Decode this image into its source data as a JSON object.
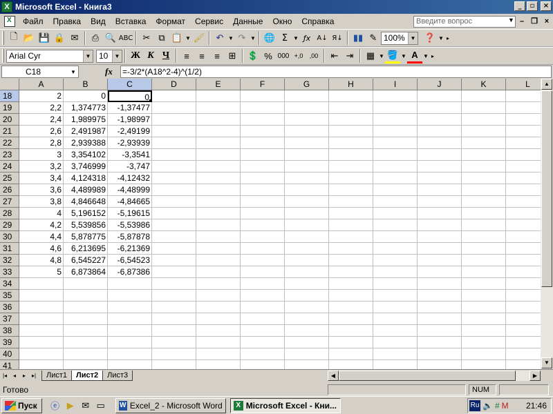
{
  "window": {
    "title": "Microsoft Excel - Книга3",
    "btn_min": "_",
    "btn_max": "▫",
    "btn_close": "×"
  },
  "menu": {
    "items": [
      "Файл",
      "Правка",
      "Вид",
      "Вставка",
      "Формат",
      "Сервис",
      "Данные",
      "Окно",
      "Справка"
    ],
    "help_placeholder": "Введите вопрос"
  },
  "toolbar": {
    "zoom": "100%",
    "font_name": "Arial Cyr",
    "font_size": "10",
    "bold": "Ж",
    "italic": "К",
    "underline": "Ч",
    "percent": "%",
    "thousands": "000",
    "inc_decimal": "+,0",
    "dec_decimal": ",00"
  },
  "formula_bar": {
    "name_box": "C18",
    "fx": "fx",
    "formula": "=-3/2*(A18^2-4)^(1/2)"
  },
  "grid": {
    "columns": [
      "A",
      "B",
      "C",
      "D",
      "E",
      "F",
      "G",
      "H",
      "I",
      "J",
      "K",
      "L"
    ],
    "selected_column": "C",
    "active_row": "18",
    "rows": [
      {
        "n": "18",
        "a": "2",
        "b": "0",
        "c": "0"
      },
      {
        "n": "19",
        "a": "2,2",
        "b": "1,374773",
        "c": "-1,37477"
      },
      {
        "n": "20",
        "a": "2,4",
        "b": "1,989975",
        "c": "-1,98997"
      },
      {
        "n": "21",
        "a": "2,6",
        "b": "2,491987",
        "c": "-2,49199"
      },
      {
        "n": "22",
        "a": "2,8",
        "b": "2,939388",
        "c": "-2,93939"
      },
      {
        "n": "23",
        "a": "3",
        "b": "3,354102",
        "c": "-3,3541"
      },
      {
        "n": "24",
        "a": "3,2",
        "b": "3,746999",
        "c": "-3,747"
      },
      {
        "n": "25",
        "a": "3,4",
        "b": "4,124318",
        "c": "-4,12432"
      },
      {
        "n": "26",
        "a": "3,6",
        "b": "4,489989",
        "c": "-4,48999"
      },
      {
        "n": "27",
        "a": "3,8",
        "b": "4,846648",
        "c": "-4,84665"
      },
      {
        "n": "28",
        "a": "4",
        "b": "5,196152",
        "c": "-5,19615"
      },
      {
        "n": "29",
        "a": "4,2",
        "b": "5,539856",
        "c": "-5,53986"
      },
      {
        "n": "30",
        "a": "4,4",
        "b": "5,878775",
        "c": "-5,87878"
      },
      {
        "n": "31",
        "a": "4,6",
        "b": "6,213695",
        "c": "-6,21369"
      },
      {
        "n": "32",
        "a": "4,8",
        "b": "6,545227",
        "c": "-6,54523"
      },
      {
        "n": "33",
        "a": "5",
        "b": "6,873864",
        "c": "-6,87386"
      },
      {
        "n": "34",
        "a": "",
        "b": "",
        "c": ""
      },
      {
        "n": "35",
        "a": "",
        "b": "",
        "c": ""
      },
      {
        "n": "36",
        "a": "",
        "b": "",
        "c": ""
      },
      {
        "n": "37",
        "a": "",
        "b": "",
        "c": ""
      },
      {
        "n": "38",
        "a": "",
        "b": "",
        "c": ""
      },
      {
        "n": "39",
        "a": "",
        "b": "",
        "c": ""
      },
      {
        "n": "40",
        "a": "",
        "b": "",
        "c": ""
      },
      {
        "n": "41",
        "a": "",
        "b": "",
        "c": ""
      }
    ]
  },
  "sheets": {
    "tabs": [
      "Лист1",
      "Лист2",
      "Лист3"
    ],
    "active": "Лист2"
  },
  "status": {
    "text": "Готово",
    "num": "NUM"
  },
  "taskbar": {
    "start": "Пуск",
    "tasks": [
      {
        "label": "Excel_2 - Microsoft Word",
        "active": false
      },
      {
        "label": "Microsoft Excel - Кни...",
        "active": true
      }
    ],
    "lang": "Ru",
    "clock": "21:46"
  }
}
